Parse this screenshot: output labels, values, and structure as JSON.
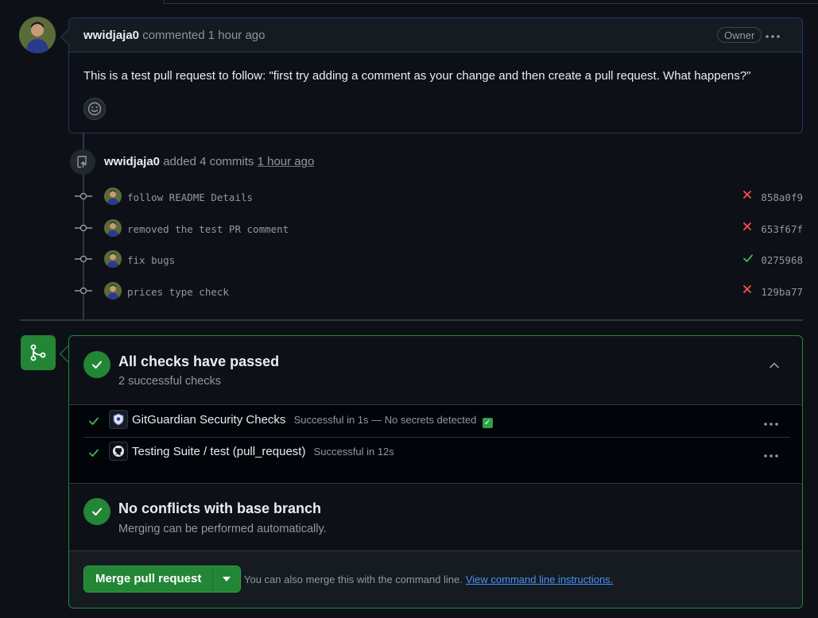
{
  "comment": {
    "author": "wwidjaja0",
    "action": "commented",
    "time": "1 hour ago",
    "badge": "Owner",
    "body": "This is a test pull request to follow: \"first try adding a comment as your change and then create a pull request. What happens?\""
  },
  "push_event": {
    "author": "wwidjaja0",
    "action": "added 4 commits",
    "time": "1 hour ago"
  },
  "commits": [
    {
      "message": "follow README Details",
      "status": "fail",
      "sha": "858a0f9"
    },
    {
      "message": "removed the test PR comment",
      "status": "fail",
      "sha": "653f67f"
    },
    {
      "message": "fix bugs",
      "status": "success",
      "sha": "0275968"
    },
    {
      "message": "prices type check",
      "status": "fail",
      "sha": "129ba77"
    }
  ],
  "checks_section": {
    "title": "All checks have passed",
    "subtitle": "2 successful checks",
    "items": [
      {
        "name": "GitGuardian Security Checks",
        "detail": "Successful in 1s — No secrets detected",
        "icon": "gitguardian-icon"
      },
      {
        "name": "Testing Suite / test (pull_request)",
        "detail": "Successful in 12s",
        "icon": "github-icon"
      }
    ]
  },
  "conflicts_section": {
    "title": "No conflicts with base branch",
    "subtitle": "Merging can be performed automatically."
  },
  "merge": {
    "button_label": "Merge pull request",
    "help_text": "You can also merge this with the command line.",
    "help_link": "View command line instructions."
  },
  "colors": {
    "success": "#3fb950",
    "fail": "#f85149",
    "accent_green": "#238636",
    "link": "#4493f8"
  }
}
